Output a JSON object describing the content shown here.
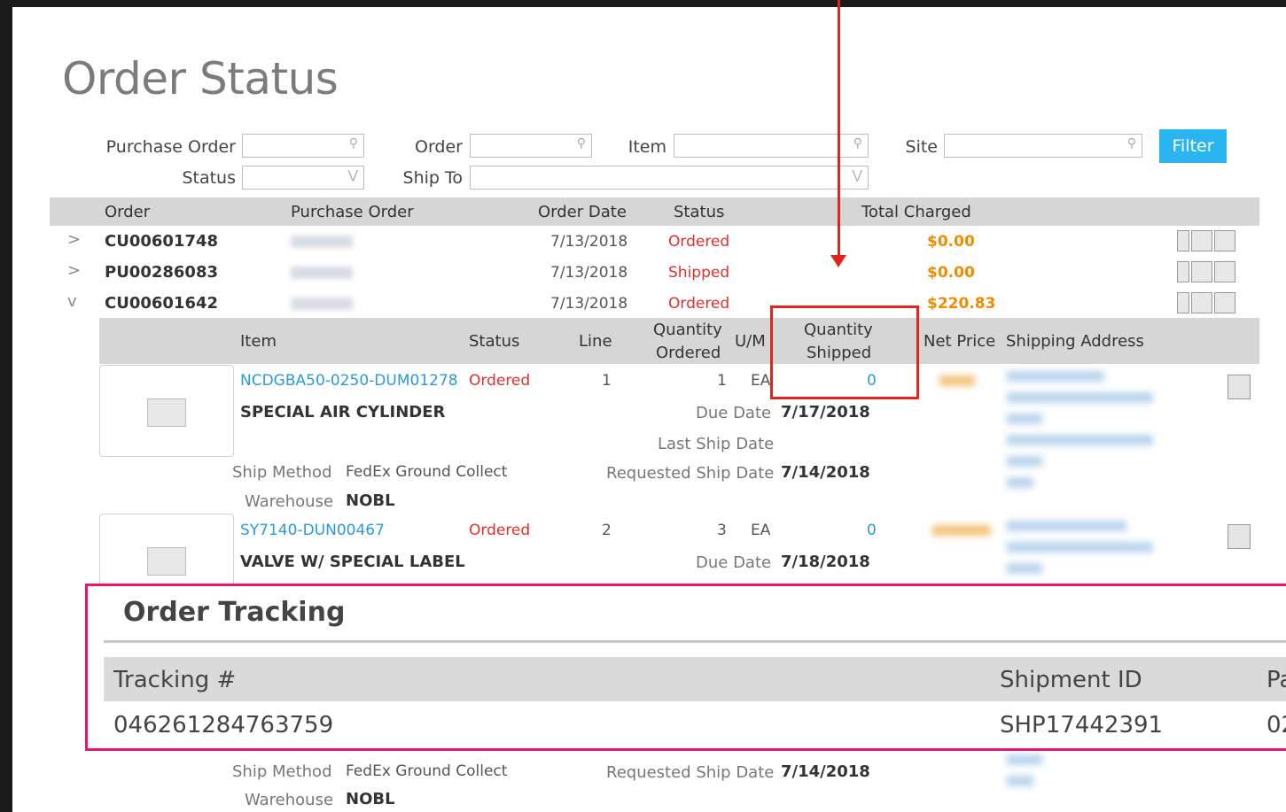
{
  "page": {
    "title": "Order Status"
  },
  "filters": {
    "purchase_order_label": "Purchase Order",
    "order_label": "Order",
    "item_label": "Item",
    "site_label": "Site",
    "status_label": "Status",
    "ship_to_label": "Ship To",
    "filter_button": "Filter"
  },
  "orders_table": {
    "headers": [
      "Order",
      "Purchase Order",
      "Order Date",
      "Status",
      "Total Charged"
    ],
    "rows": [
      {
        "order": "CU00601748",
        "date": "7/13/2018",
        "status": "Ordered",
        "total": "$0.00",
        "chevron": ">"
      },
      {
        "order": "PU00286083",
        "date": "7/13/2018",
        "status": "Shipped",
        "total": "$0.00",
        "chevron": ">"
      },
      {
        "order": "CU00601642",
        "date": "7/13/2018",
        "status": "Ordered",
        "total": "$220.83",
        "chevron": "v"
      }
    ]
  },
  "lines_table": {
    "headers": {
      "item": "Item",
      "status": "Status",
      "line": "Line",
      "qty_ordered_1": "Quantity",
      "qty_ordered_2": "Ordered",
      "um": "U/M",
      "qty_shipped_1": "Quantity",
      "qty_shipped_2": "Shipped",
      "net_price": "Net Price",
      "shipping_address": "Shipping Address"
    },
    "lines": [
      {
        "item_code": "NCDGBA50-0250-DUM01278",
        "status": "Ordered",
        "line": "1",
        "qty_ordered": "1",
        "um": "EA",
        "qty_shipped": "0",
        "description": "SPECIAL AIR CYLINDER",
        "due_date_label": "Due Date",
        "due_date": "7/17/2018",
        "last_ship_label": "Last Ship Date",
        "ship_method_label": "Ship Method",
        "ship_method": "FedEx Ground Collect",
        "requested_label": "Requested Ship Date",
        "requested_date": "7/14/2018",
        "warehouse_label": "Warehouse",
        "warehouse": "NOBL"
      },
      {
        "item_code": "SY7140-DUN00467",
        "status": "Ordered",
        "line": "2",
        "qty_ordered": "3",
        "um": "EA",
        "qty_shipped": "0",
        "description": "VALVE W/ SPECIAL LABEL",
        "due_date_label": "Due Date",
        "due_date": "7/18/2018",
        "ship_method_label": "Ship Method",
        "ship_method": "FedEx Ground Collect",
        "requested_label": "Requested Ship Date",
        "requested_date": "7/14/2018",
        "warehouse_label": "Warehouse",
        "warehouse": "NOBL"
      }
    ]
  },
  "tracking": {
    "title": "Order Tracking",
    "headers": {
      "tracking": "Tracking #",
      "shipment": "Shipment ID",
      "partial": "Pa"
    },
    "row": {
      "tracking": "046261284763759",
      "shipment": "SHP17442391",
      "partial": "02"
    }
  },
  "colors": {
    "accent": "#2ab5f0",
    "status_red": "#e0302e",
    "total_orange": "#f08c00",
    "callout_red": "#e5231d",
    "callout_pink": "#e6176a"
  }
}
